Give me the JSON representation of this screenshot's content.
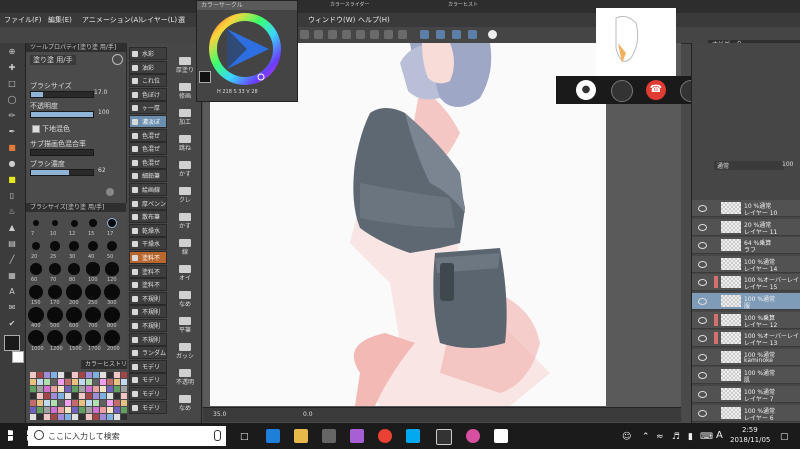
{
  "titlebar": {
    "title": ""
  },
  "menubar": {
    "items": [
      "ファイル(F)",
      "編集(E)",
      "アニメーション(A)",
      "レイヤー(L)",
      "選",
      "ウィンドウ(W)",
      "ヘルプ(H)"
    ]
  },
  "color_wheel_panel": {
    "title": "カラーサークル",
    "readout": [
      "H",
      "218",
      "S",
      "33",
      "V",
      "28"
    ]
  },
  "color_slider_tab": {
    "title": "カラースライダー"
  },
  "color_history_tab": {
    "title": "カラーヒスト"
  },
  "tool_property": {
    "header": "ツールプロパティ[塗り塗 用/手]",
    "brush_name": "塗り塗 用/手",
    "brush_size_label": "ブラシサイズ",
    "brush_size_value": "17.0",
    "opacity_label": "不透明度",
    "opacity_value": "100",
    "underlay_label": "下地混色",
    "sub_label": "サブ描画色混合率",
    "density_label": "ブラシ濃度",
    "density_value": "62"
  },
  "brush_size_panel": {
    "header": "ブラシサイズ[塗り塗 用/手]",
    "sizes": [
      "7",
      "10",
      "12",
      "15",
      "17",
      "20",
      "25",
      "30",
      "40",
      "50",
      "60",
      "70",
      "80",
      "100",
      "120",
      "150",
      "170",
      "200",
      "250",
      "300",
      "400",
      "500",
      "600",
      "700",
      "800",
      "1000",
      "1200",
      "1500",
      "1700",
      "2000"
    ]
  },
  "color_history_panel": {
    "header": "カラーヒストリ"
  },
  "sub_tool_panel": {
    "items": [
      "水彩",
      "油彩",
      "これ位",
      "色ぼけ",
      "ヶ一厚",
      "濃淡ぼ",
      "色混ぜ",
      "色混ぜ",
      "色混ぜ",
      "細鉛筆",
      "絵画線",
      "厚ペンン",
      "散布筆",
      "乾燥水",
      "干燥水",
      "塗料不",
      "塗料不",
      "塗料不",
      "不規則",
      "不規則",
      "不規則",
      "不規則",
      "ランダム",
      "モデリ",
      "モデリ",
      "モデリ",
      "モデリ"
    ]
  },
  "tool_column_2": {
    "items": [
      "厚塗り",
      "修画",
      "加工",
      "跳ね",
      "かす",
      "クレ",
      "かす",
      "線",
      "オイ",
      "なめ",
      "平筆",
      "ガッシ",
      "不透明",
      "なめ"
    ]
  },
  "canvas_status": {
    "zoom": "35.0",
    "angle": "0.0"
  },
  "layer_panel": {
    "blend_mode": "通常",
    "opacity_value": "100",
    "layers": [
      {
        "pct_mode": "10 %通常",
        "name": "レイヤー 10",
        "selected": false,
        "red_mark": false
      },
      {
        "pct_mode": "20 %通常",
        "name": "レイヤー 11",
        "selected": false,
        "red_mark": false
      },
      {
        "pct_mode": "64 %乗算",
        "name": "ラフ",
        "selected": false,
        "red_mark": false
      },
      {
        "pct_mode": "100 %通常",
        "name": "レイヤー 14",
        "selected": false,
        "red_mark": false
      },
      {
        "pct_mode": "100 %オーバーレイ",
        "name": "レイヤー 15",
        "selected": false,
        "red_mark": true
      },
      {
        "pct_mode": "100 %通常",
        "name": "服",
        "selected": true,
        "red_mark": false
      },
      {
        "pct_mode": "100 %乗算",
        "name": "レイヤー 12",
        "selected": false,
        "red_mark": true
      },
      {
        "pct_mode": "100 %オーバーレイ",
        "name": "レイヤー 13",
        "selected": false,
        "red_mark": true
      },
      {
        "pct_mode": "100 %通常",
        "name": "kaminoke",
        "selected": false,
        "red_mark": false
      },
      {
        "pct_mode": "100 %通常",
        "name": "肌",
        "selected": false,
        "red_mark": false
      },
      {
        "pct_mode": "100 %通常",
        "name": "レイヤー 7",
        "selected": false,
        "red_mark": false
      },
      {
        "pct_mode": "100 %通常",
        "name": "レイヤー 6",
        "selected": false,
        "red_mark": false
      }
    ]
  },
  "navigator": {
    "header": "ナビゲーター",
    "zoom": "35.0"
  },
  "taskbar": {
    "search_placeholder": "ここに入力して検索",
    "time": "2:59",
    "date": "2018/11/05",
    "ime": "A"
  },
  "colors": {
    "accent": "#6b8dae",
    "active_tool": "#b9672f",
    "hang_up": "#e03c31",
    "skin_shadow": "#f2b9b5",
    "clothes": "#5d6873",
    "hair": "#9ea7c6"
  }
}
